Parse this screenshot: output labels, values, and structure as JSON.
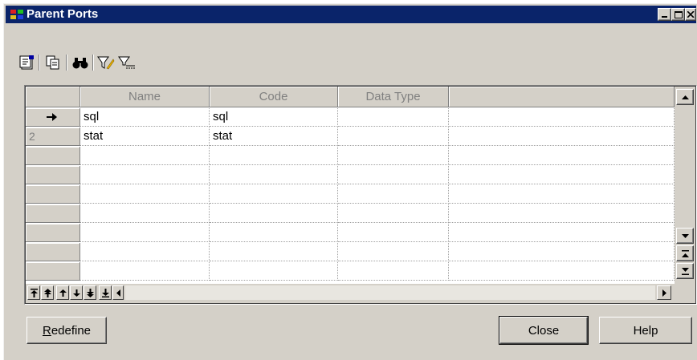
{
  "window": {
    "title": "Parent Ports"
  },
  "toolbar": {
    "icons": [
      "properties-icon",
      "copy-icon",
      "find-icon",
      "filter-icon",
      "filter-settings-icon"
    ]
  },
  "grid": {
    "columns": [
      "Name",
      "Code",
      "Data Type",
      ""
    ],
    "rows": [
      {
        "row_label": "",
        "current": true,
        "name": "sql",
        "code": "sql",
        "data_type": ""
      },
      {
        "row_label": "2",
        "current": false,
        "name": "stat",
        "code": "stat",
        "data_type": ""
      }
    ],
    "empty_rows": 7
  },
  "buttons": {
    "redefine_underlined": "R",
    "redefine_rest": "edefine",
    "close": "Close",
    "help": "Help"
  },
  "colors": {
    "titlebar": "#0a246a",
    "face": "#d4d0c8"
  }
}
